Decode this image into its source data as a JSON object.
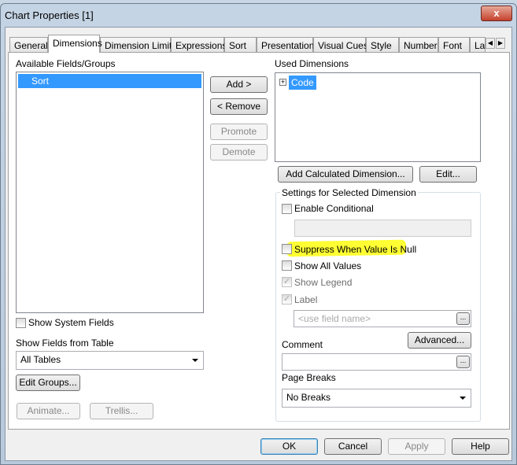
{
  "window": {
    "title": "Chart Properties [1]",
    "close": "x"
  },
  "tabs": [
    "General",
    "Dimensions",
    "Dimension Limits",
    "Expressions",
    "Sort",
    "Presentation",
    "Visual Cues",
    "Style",
    "Number",
    "Font",
    "La"
  ],
  "active_tab": "Dimensions",
  "available": {
    "label": "Available Fields/Groups",
    "items": [
      "Sort"
    ]
  },
  "buttons": {
    "add": "Add >",
    "remove": "< Remove",
    "promote": "Promote",
    "demote": "Demote",
    "add_calc": "Add Calculated Dimension...",
    "edit": "Edit...",
    "edit_groups": "Edit Groups...",
    "animate": "Animate...",
    "trellis": "Trellis...",
    "advanced": "Advanced...",
    "dots": "..."
  },
  "used": {
    "label": "Used Dimensions",
    "items": [
      "Code"
    ]
  },
  "show_system_fields": {
    "label": "Show System Fields",
    "checked": false
  },
  "show_fields_from": {
    "label": "Show Fields from Table",
    "value": "All Tables"
  },
  "settings": {
    "title": "Settings for Selected Dimension",
    "enable_conditional": {
      "label": "Enable Conditional",
      "checked": false
    },
    "suppress_null": {
      "label": "Suppress When Value Is Null",
      "checked": false,
      "highlight": "#ffff33"
    },
    "show_all_values": {
      "label": "Show All Values",
      "checked": false
    },
    "show_legend": {
      "label": "Show Legend",
      "checked": true,
      "disabled": true
    },
    "label": {
      "label": "Label",
      "checked": true,
      "disabled": true
    },
    "label_placeholder": "<use field name>",
    "comment": {
      "label": "Comment",
      "value": ""
    },
    "page_breaks": {
      "label": "Page Breaks",
      "value": "No Breaks"
    }
  },
  "footer": {
    "ok": "OK",
    "cancel": "Cancel",
    "apply": "Apply",
    "help": "Help"
  }
}
